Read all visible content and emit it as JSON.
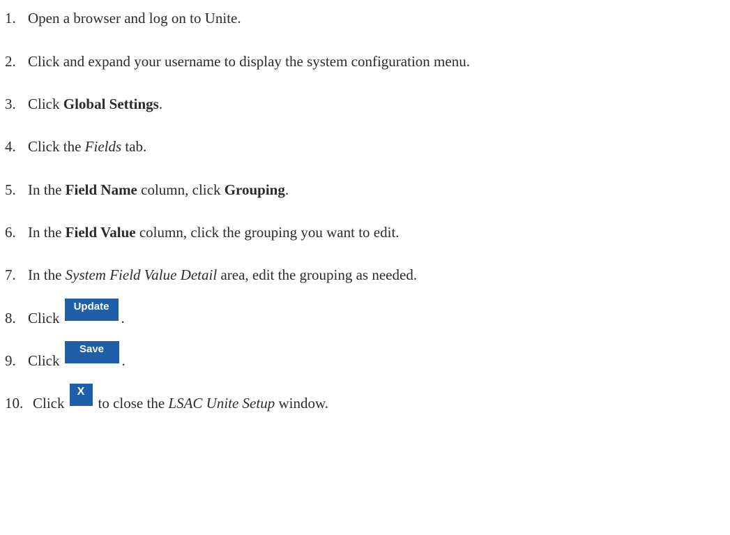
{
  "steps": [
    {
      "num": "1.",
      "text": "Open a browser and log on to Unite."
    },
    {
      "num": "2.",
      "text": "Click and expand your username to display the system configuration menu."
    },
    {
      "num": "3.",
      "pre": "Click ",
      "bold": "Global Settings",
      "post": "."
    },
    {
      "num": "4.",
      "pre": "Click the ",
      "italic": "Fields",
      "post": " tab."
    },
    {
      "num": "5.",
      "pre": "In the ",
      "bold1": "Field Name",
      "mid": " column, click ",
      "bold2": "Grouping",
      "post": "."
    },
    {
      "num": "6.",
      "pre": "In the ",
      "bold": "Field Value",
      "post": " column, click the grouping you want to edit."
    },
    {
      "num": "7.",
      "pre": "In the ",
      "italic": "System Field Value Detail",
      "post": " area, edit the grouping as needed."
    },
    {
      "num": "8.",
      "pre": "Click",
      "button": "Update",
      "post": "."
    },
    {
      "num": "9.",
      "pre": "Click",
      "button": "Save",
      "post": "."
    },
    {
      "num": "10.",
      "pre": "Click",
      "button": "X",
      "mid": "to close the ",
      "italic": "LSAC Unite Setup",
      "post": " window."
    }
  ]
}
